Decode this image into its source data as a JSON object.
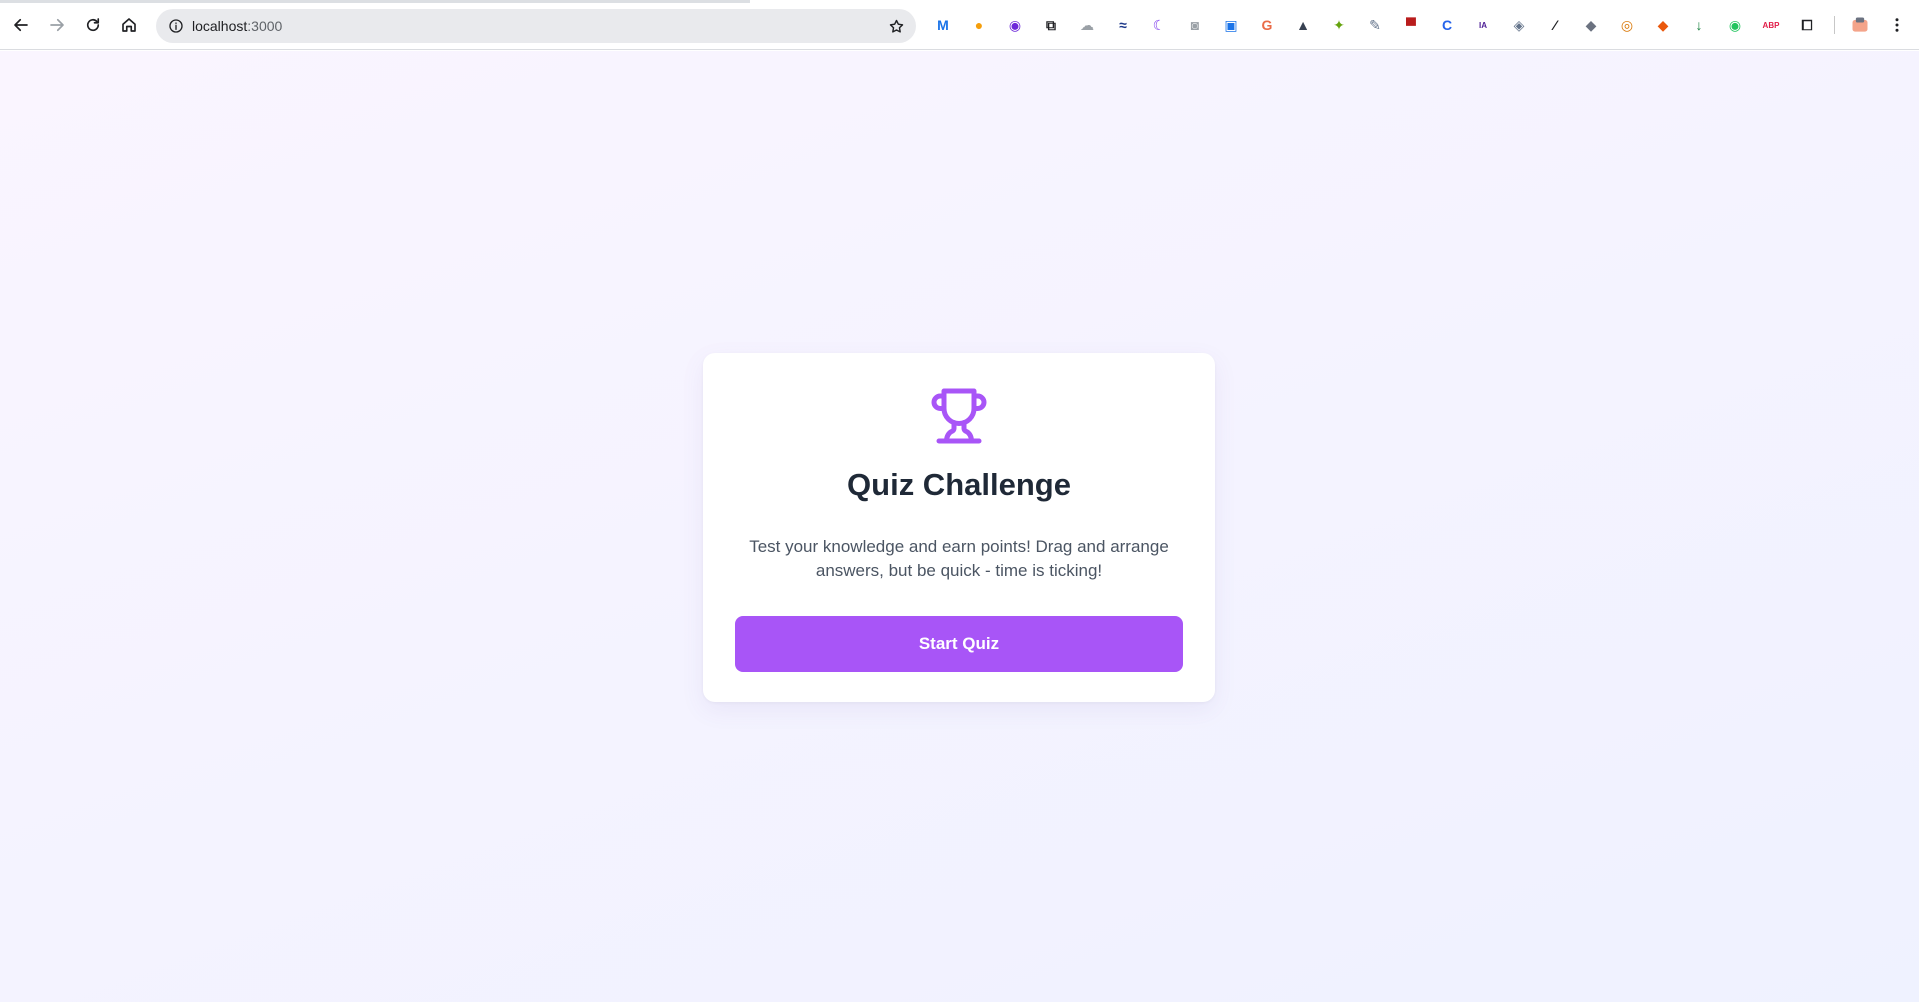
{
  "browser": {
    "url_host": "localhost",
    "url_port": ":3000",
    "extensions": [
      {
        "name": "meta-extension-icon",
        "glyph": "M",
        "color": "#1a73e8"
      },
      {
        "name": "orange-circle-extension-icon",
        "glyph": "●",
        "color": "#f59e0b"
      },
      {
        "name": "purple-circle-extension-icon",
        "glyph": "◉",
        "color": "#6d28d9"
      },
      {
        "name": "link-extension-icon",
        "glyph": "⧉",
        "color": "#202124"
      },
      {
        "name": "cloud-extension-icon",
        "glyph": "☁",
        "color": "#9aa0a6"
      },
      {
        "name": "chart-extension-icon",
        "glyph": "≈",
        "color": "#1e3a8a"
      },
      {
        "name": "moon-extension-icon",
        "glyph": "☾",
        "color": "#7c3aed"
      },
      {
        "name": "camera-extension-icon",
        "glyph": "◙",
        "color": "#9aa0a6"
      },
      {
        "name": "screen-extension-icon",
        "glyph": "▣",
        "color": "#1a73e8"
      },
      {
        "name": "g-extension-icon",
        "glyph": "G",
        "color": "#ea6b47"
      },
      {
        "name": "ship-extension-icon",
        "glyph": "▲",
        "color": "#374151"
      },
      {
        "name": "bird-extension-icon",
        "glyph": "✦",
        "color": "#65a30d"
      },
      {
        "name": "tool-extension-icon",
        "glyph": "✎",
        "color": "#64748b"
      },
      {
        "name": "hat-extension-icon",
        "glyph": "▀",
        "color": "#b91c1c"
      },
      {
        "name": "c-extension-icon",
        "glyph": "C",
        "color": "#2563eb"
      },
      {
        "name": "ia-extension-icon",
        "glyph": "IA",
        "color": "#4c1d95"
      },
      {
        "name": "target-extension-icon",
        "glyph": "◈",
        "color": "#64748b"
      },
      {
        "name": "pen-extension-icon",
        "glyph": "⁄",
        "color": "#202124"
      },
      {
        "name": "shield-extension-icon",
        "glyph": "◆",
        "color": "#6b7280"
      },
      {
        "name": "chrome-extension-icon",
        "glyph": "◎",
        "color": "#d97706"
      },
      {
        "name": "diamond-extension-icon",
        "glyph": "◆",
        "color": "#ea580c"
      },
      {
        "name": "download-extension-icon",
        "glyph": "↓",
        "color": "#15803d"
      },
      {
        "name": "eye-extension-icon",
        "glyph": "◉",
        "color": "#22c55e"
      },
      {
        "name": "abp-extension-icon",
        "glyph": "ABP",
        "color": "#e11d48"
      },
      {
        "name": "puzzle-extension-icon",
        "glyph": "⧠",
        "color": "#202124"
      }
    ]
  },
  "quiz": {
    "title": "Quiz Challenge",
    "description": "Test your knowledge and earn points! Drag and arrange answers, but be quick - time is ticking!",
    "start_label": "Start Quiz",
    "icon": "trophy-icon",
    "accent_color": "#a855f7"
  }
}
